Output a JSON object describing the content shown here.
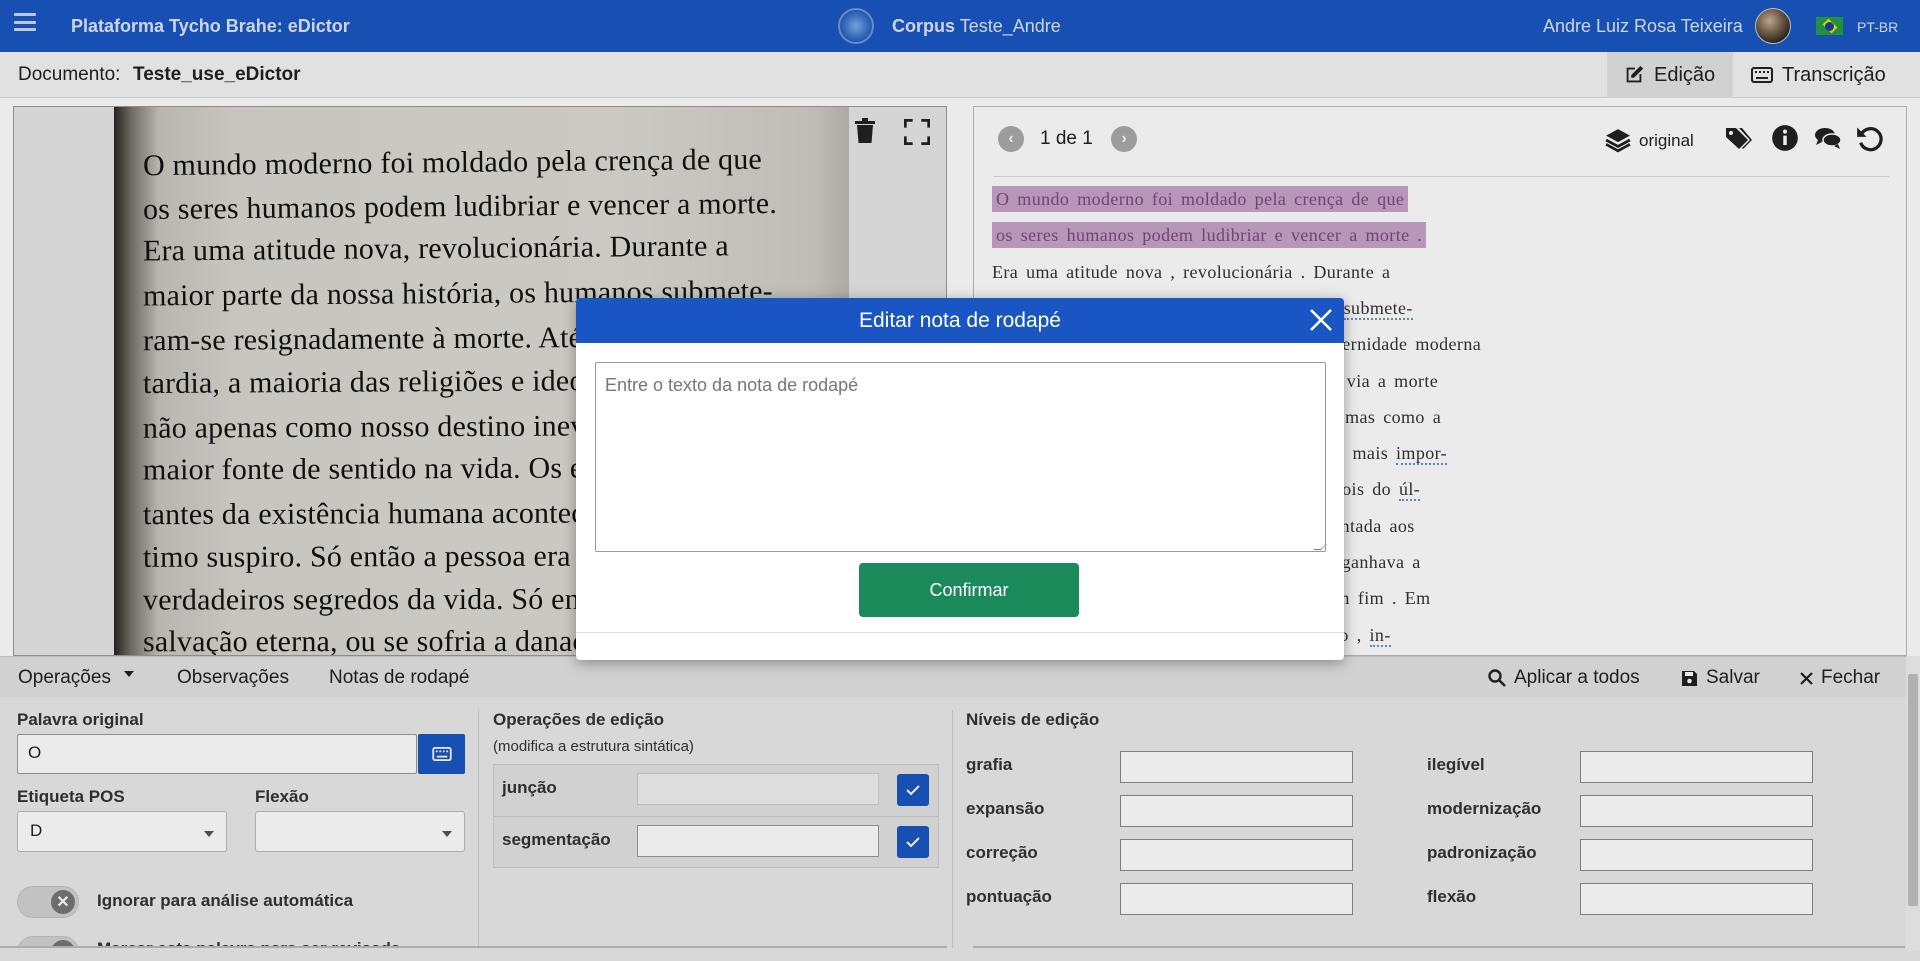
{
  "app": {
    "title": "Plataforma Tycho Brahe: eDictor",
    "corpus_label": "Corpus",
    "corpus_name": "Teste_Andre",
    "user": "Andre Luiz Rosa Teixeira",
    "lang": "PT-BR"
  },
  "doc": {
    "label": "Documento:",
    "name": "Teste_use_eDictor",
    "tabs": [
      {
        "label": "Edição",
        "icon": "edit-icon",
        "active": true
      },
      {
        "label": "Transcrição",
        "icon": "keyboard-icon",
        "active": false
      }
    ]
  },
  "image_pane": {
    "lines": [
      "O mundo moderno foi moldado pela crença de que",
      "os seres humanos podem ludibriar e vencer a morte.",
      "Era uma atitude nova, revolucionária. Durante a",
      "maior parte da nossa história, os humanos submete-",
      "ram-se resignadamente à morte. Até a modernidade",
      "tardia, a maioria das religiões e ideologias via a morte",
      "não apenas como nosso destino inevitável, mas como a",
      "maior fonte de sentido na vida. Os eventos mais impor-",
      "tantes da existência humana aconteciam depois do úl-",
      "timo suspiro. Só então a pessoa era apresentada aos",
      "verdadeiros segredos da vida. Só então se ganhava a",
      "salvação eterna, ou se sofria a danação sem fim. Em"
    ]
  },
  "text_pane": {
    "page_info": "1 de 1",
    "view_label": "original",
    "lines": [
      {
        "parts": [
          {
            "t": "O mundo moderno foi moldado pela crença de que",
            "hl": true
          }
        ]
      },
      {
        "parts": [
          {
            "t": "os seres humanos podem ludibriar e vencer a morte .",
            "hl": true
          }
        ]
      },
      {
        "parts": [
          {
            "t": "Era uma atitude nova , revolucionária . Durante a"
          }
        ]
      },
      {
        "parts": [
          {
            "t": "maior parte da nossa história , os humanos "
          },
          {
            "t": "submete-",
            "tok": true
          }
        ]
      },
      {
        "parts": [
          {
            "t": "ram-se resignadamente à morte . Até a modernidade moderna"
          }
        ]
      },
      {
        "parts": [
          {
            "t": "tardia , a maioria das religiões e ideologias via a morte"
          }
        ]
      },
      {
        "parts": [
          {
            "t": "não apenas como nosso destino inevitável , mas como a"
          }
        ]
      },
      {
        "parts": [
          {
            "t": "maior fonte de sentido na vida . Os eventos mais "
          },
          {
            "t": "impor-",
            "tok": true
          }
        ]
      },
      {
        "parts": [
          {
            "t": "tantes da existência humana aconteciam depois do "
          },
          {
            "t": "úl-",
            "tok": true
          }
        ]
      },
      {
        "parts": [
          {
            "t": "timo suspiro . Só então a pessoa era apresentada aos"
          }
        ]
      },
      {
        "parts": [
          {
            "t": "verdadeiros segredos da vida . Só então se ganhava a"
          }
        ]
      },
      {
        "parts": [
          {
            "t": "salvação eterna , ou se sofria a danação sem fim . Em"
          }
        ]
      },
      {
        "parts": [
          {
            "t": "vez de um mundo que terminasse no paraíso , "
          },
          {
            "t": "in-",
            "tok": true
          }
        ]
      }
    ]
  },
  "bottom": {
    "tabs": [
      "Operações",
      "Observações",
      "Notas de rodapé"
    ],
    "actions": [
      {
        "label": "Aplicar a todos",
        "icon": "search-icon"
      },
      {
        "label": "Salvar",
        "icon": "save-icon"
      },
      {
        "label": "Fechar",
        "icon": "close-icon"
      }
    ],
    "original_word_label": "Palavra original",
    "original_word": "O",
    "pos_label": "Etiqueta POS",
    "pos_value": "D",
    "flexao_label": "Flexão",
    "flexao_value": "",
    "toggle1": "Ignorar para análise automática",
    "toggle2": "Marcar esta palavra para ser revisada",
    "ops_title": "Operações de edição",
    "ops_sub": "(modifica a estrutura sintática)",
    "ops": [
      "junção",
      "segmentação"
    ],
    "levels_title": "Níveis de edição",
    "levels_left": [
      "grafia",
      "expansão",
      "correção",
      "pontuação"
    ],
    "levels_right": [
      "ilegível",
      "modernização",
      "padronização",
      "flexão"
    ]
  },
  "modal": {
    "title": "Editar nota de rodapé",
    "placeholder": "Entre o texto da nota de rodapé",
    "confirm": "Confirmar"
  },
  "colors": {
    "brand": "#1a56c3",
    "confirm": "#1b8a5a",
    "highlight": "#c7a3c9"
  }
}
